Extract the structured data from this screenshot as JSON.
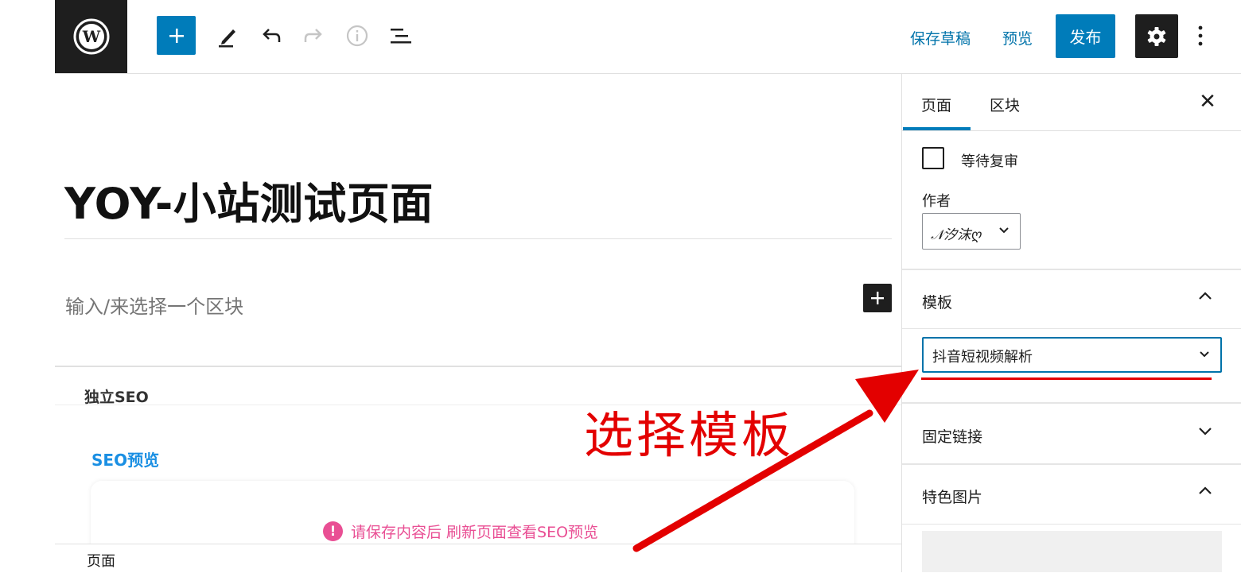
{
  "toolbar": {
    "save_draft": "保存草稿",
    "preview": "预览",
    "publish": "发布"
  },
  "editor": {
    "title": "YOY-小站测试页面",
    "block_placeholder": "输入/来选择一个区块"
  },
  "seo_box": {
    "header": "独立SEO",
    "preview_title": "SEO预览",
    "notice_icon": "!",
    "notice": "请保存内容后 刷新页面查看SEO预览"
  },
  "footer": {
    "breadcrumb": "页面"
  },
  "sidebar": {
    "tabs": [
      {
        "label": "页面",
        "active": true
      },
      {
        "label": "区块",
        "active": false
      }
    ],
    "close": "✕",
    "pending_review_label": "等待复审",
    "pending_review_checked": false,
    "author_label": "作者",
    "author_value": "𝒩汐沫ღ",
    "template": {
      "title": "模板",
      "value": "抖音短视频解析",
      "expanded": true
    },
    "permalink": {
      "title": "固定链接",
      "expanded": false
    },
    "featured_image": {
      "title": "特色图片",
      "expanded": true
    }
  },
  "annotation": {
    "text": "选择模板",
    "color": "#e30000"
  },
  "colors": {
    "accent": "#007cba",
    "link": "#0073aa",
    "dark": "#1e1e1e",
    "seo_blue": "#1a8fe3",
    "notice_pink": "#e94f94"
  }
}
